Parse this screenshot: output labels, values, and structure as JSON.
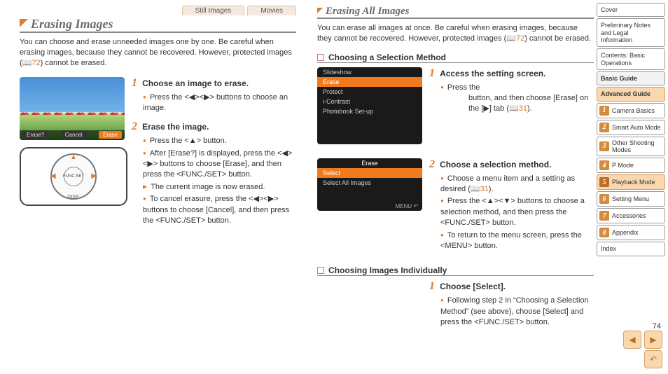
{
  "left": {
    "tabs": [
      "Still Images",
      "Movies"
    ],
    "title": "Erasing Images",
    "intro_a": "You can choose and erase unneeded images one by one. Be careful when erasing images, because they cannot be recovered. However, protected images (",
    "intro_ref": "72",
    "intro_b": ") cannot be erased.",
    "shot": {
      "label_left": "Erase?",
      "label_mid": "Cancel",
      "label_right": "Erase"
    },
    "dial": {
      "center_top": "FUNC.",
      "center_bot": "SET",
      "bottom": "DISP."
    },
    "steps": [
      {
        "num": "1",
        "title": "Choose an image to erase.",
        "bullets": [
          {
            "text": "Press the <◀><▶> buttons to choose an image."
          }
        ]
      },
      {
        "num": "2",
        "title": "Erase the image.",
        "bullets": [
          {
            "text": "Press the <▲> button."
          },
          {
            "text": "After [Erase?] is displayed, press the <◀><▶> buttons to choose [Erase], and then press the <FUNC./SET> button."
          },
          {
            "arrow": true,
            "text": "The current image is now erased."
          },
          {
            "text": "To cancel erasure, press the <◀><▶> buttons to choose [Cancel], and then press the <FUNC./SET> button."
          }
        ]
      }
    ]
  },
  "right": {
    "title": "Erasing All Images",
    "intro_a": "You can erase all images at once. Be careful when erasing images, because they cannot be recovered. However, protected images (",
    "intro_ref": "72",
    "intro_b": ") cannot be erased.",
    "sub1": "Choosing a Selection Method",
    "shot1_items": [
      "Slideshow",
      "Erase",
      "Protect",
      "i-Contrast",
      "Photobook Set-up"
    ],
    "shot2_header": "Erase",
    "shot2_items": [
      "Select",
      "Select All Images"
    ],
    "shot2_foot": "MENU ↶",
    "step1": {
      "num": "1",
      "title": "Access the setting screen.",
      "bullets": [
        {
          "text": "Press the <MENU> button, and then choose [Erase] on the [▶] tab (",
          "ref": "31",
          "tail": ")."
        }
      ]
    },
    "step2": {
      "num": "2",
      "title": "Choose a selection method.",
      "bullets": [
        {
          "text": "Choose a menu item and a setting as desired (",
          "ref": "31",
          "tail": ")."
        },
        {
          "text": "Press the <▲><▼> buttons to choose a selection method, and then press the <FUNC./SET> button."
        },
        {
          "text": "To return to the menu screen, press the <MENU> button."
        }
      ]
    },
    "sub2": "Choosing Images Individually",
    "step3": {
      "num": "1",
      "title": "Choose [Select].",
      "bullets": [
        {
          "text": "Following step 2 in “Choosing a Selection Method” (see above), choose [Select] and press the <FUNC./SET> button."
        }
      ]
    }
  },
  "nav": {
    "top": [
      {
        "label": "Cover"
      },
      {
        "label": "Preliminary Notes and Legal Information"
      },
      {
        "label": "Contents: Basic Operations"
      }
    ],
    "major": [
      {
        "label": "Basic Guide",
        "active": false
      },
      {
        "label": "Advanced Guide",
        "active": true
      }
    ],
    "subs": [
      {
        "n": "1",
        "label": "Camera Basics"
      },
      {
        "n": "2",
        "label": "Smart Auto Mode"
      },
      {
        "n": "3",
        "label": "Other Shooting Modes"
      },
      {
        "n": "4",
        "label": "P Mode"
      },
      {
        "n": "5",
        "label": "Playback Mode",
        "active": true
      },
      {
        "n": "6",
        "label": "Setting Menu"
      },
      {
        "n": "7",
        "label": "Accessories"
      },
      {
        "n": "8",
        "label": "Appendix"
      }
    ],
    "bottom": [
      {
        "label": "Index"
      }
    ]
  },
  "page_number": "74",
  "pager": {
    "prev": "◀",
    "next": "▶",
    "back": "↶"
  }
}
